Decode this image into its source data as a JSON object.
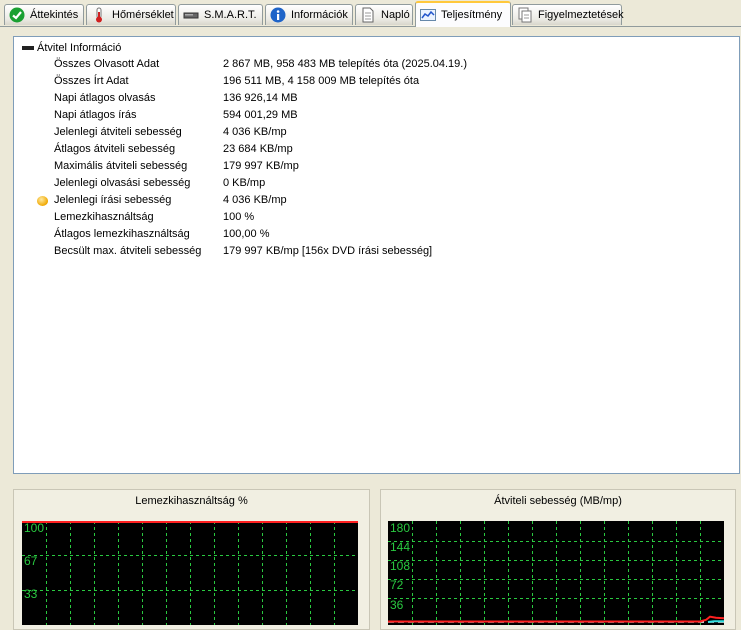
{
  "tabs": [
    {
      "label": "Áttekintés",
      "icon": "check-circle-icon",
      "active": false
    },
    {
      "label": "Hőmérséklet",
      "icon": "thermometer-icon",
      "active": false
    },
    {
      "label": "S.M.A.R.T.",
      "icon": "drive-icon",
      "active": false
    },
    {
      "label": "Információk",
      "icon": "info-icon",
      "active": false
    },
    {
      "label": "Napló",
      "icon": "document-icon",
      "active": false
    },
    {
      "label": "Teljesítmény",
      "icon": "chart-icon",
      "active": true
    },
    {
      "label": "Figyelmeztetések",
      "icon": "pages-icon",
      "active": false
    }
  ],
  "tree": {
    "root_label": "Átvitel Információ",
    "rows": [
      {
        "name": "Összes Olvasott Adat",
        "value": "2 867 MB,  958 483 MB telepítés óta  (2025.04.19.)"
      },
      {
        "name": "Összes Írt Adat",
        "value": "196 511 MB,  4 158 009 MB telepítés óta"
      },
      {
        "name": "Napi átlagos olvasás",
        "value": "136 926,14 MB"
      },
      {
        "name": "Napi átlagos írás",
        "value": "594 001,29 MB"
      },
      {
        "name": "Jelenlegi átviteli sebesség",
        "value": "4 036 KB/mp"
      },
      {
        "name": "Átlagos átviteli sebesség",
        "value": "23 684 KB/mp"
      },
      {
        "name": "Maximális átviteli sebesség",
        "value": "179 997 KB/mp"
      },
      {
        "name": "Jelenlegi olvasási sebesség",
        "value": "0 KB/mp"
      },
      {
        "name": "Jelenlegi írási sebesség",
        "value": "4 036 KB/mp",
        "warning": true
      },
      {
        "name": "Lemezkihasználtság",
        "value": "100 %"
      },
      {
        "name": "Átlagos lemezkihasználtság",
        "value": "100,00 %"
      },
      {
        "name": "Becsült max. átviteli sebesség",
        "value": "179 997 KB/mp [156x DVD írási sebesség]"
      }
    ]
  },
  "graphs": {
    "usage": {
      "title": "Lemezkihasználtság %",
      "ticks": [
        "100",
        "67",
        "33"
      ],
      "line_color": "#ff2020",
      "level_percent": 100
    },
    "transfer": {
      "title": "Átviteli sebesség (MB/mp)",
      "ticks": [
        "180",
        "144",
        "108",
        "72",
        "36"
      ],
      "max": 180,
      "line_color": "#ff2020",
      "line2_color": "#30e0e0"
    }
  },
  "colors": {
    "grid": "#29c940",
    "accent": "#ffc83c"
  }
}
